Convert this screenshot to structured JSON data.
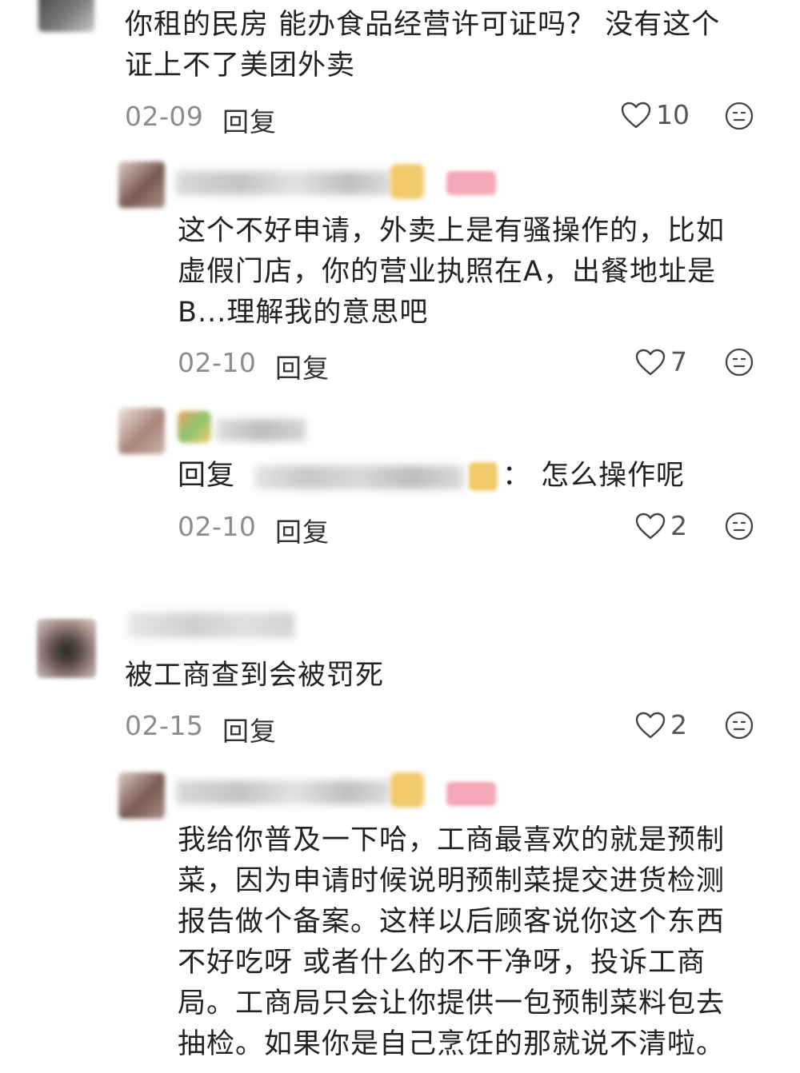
{
  "comments": [
    {
      "text_lines": [
        "你租的民房 能办食品经营许可证吗？ 没有这个",
        "证上不了美团外卖"
      ],
      "date": "02-09",
      "reply_label": "回复",
      "likes": "10"
    },
    {
      "text_lines": [
        "这个不好申请，外卖上是有骚操作的，比如",
        "虚假门店，你的营业执照在A，出餐地址是",
        "B...理解我的意思吧"
      ],
      "date": "02-10",
      "reply_label": "回复",
      "likes": "7"
    },
    {
      "reply_prefix": "回复",
      "reply_suffix": "：  怎么操作呢",
      "date": "02-10",
      "reply_label": "回复",
      "likes": "2"
    },
    {
      "text_lines": [
        "被工商查到会被罚死"
      ],
      "date": "02-15",
      "reply_label": "回复",
      "likes": "2"
    },
    {
      "text_lines": [
        "我给你普及一下哈，工商最喜欢的就是预制",
        "菜，因为申请时候说明预制菜提交进货检测",
        "报告做个备案。这样以后顾客说你这个东西",
        "不好吃呀 或者什么的不干净呀，投诉工商",
        "局。工商局只会让你提供一包预制菜料包去",
        "抽检。如果你是自己烹饪的那就说不清啦。"
      ]
    }
  ],
  "colors": {
    "date": "#8c8c8c",
    "text": "#222222",
    "badge": "#f4a7b4",
    "thumb": "#f2c96b"
  },
  "icons": {
    "like": "heart-outline-icon",
    "emoji": "emoji-face-icon"
  }
}
